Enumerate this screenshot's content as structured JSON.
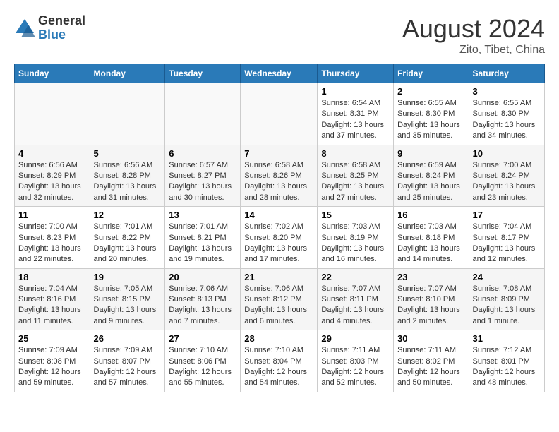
{
  "logo": {
    "general": "General",
    "blue": "Blue"
  },
  "title": "August 2024",
  "subtitle": "Zito, Tibet, China",
  "days_header": [
    "Sunday",
    "Monday",
    "Tuesday",
    "Wednesday",
    "Thursday",
    "Friday",
    "Saturday"
  ],
  "weeks": [
    [
      {
        "day": "",
        "info": ""
      },
      {
        "day": "",
        "info": ""
      },
      {
        "day": "",
        "info": ""
      },
      {
        "day": "",
        "info": ""
      },
      {
        "day": "1",
        "info": "Sunrise: 6:54 AM\nSunset: 8:31 PM\nDaylight: 13 hours and 37 minutes."
      },
      {
        "day": "2",
        "info": "Sunrise: 6:55 AM\nSunset: 8:30 PM\nDaylight: 13 hours and 35 minutes."
      },
      {
        "day": "3",
        "info": "Sunrise: 6:55 AM\nSunset: 8:30 PM\nDaylight: 13 hours and 34 minutes."
      }
    ],
    [
      {
        "day": "4",
        "info": "Sunrise: 6:56 AM\nSunset: 8:29 PM\nDaylight: 13 hours and 32 minutes."
      },
      {
        "day": "5",
        "info": "Sunrise: 6:56 AM\nSunset: 8:28 PM\nDaylight: 13 hours and 31 minutes."
      },
      {
        "day": "6",
        "info": "Sunrise: 6:57 AM\nSunset: 8:27 PM\nDaylight: 13 hours and 30 minutes."
      },
      {
        "day": "7",
        "info": "Sunrise: 6:58 AM\nSunset: 8:26 PM\nDaylight: 13 hours and 28 minutes."
      },
      {
        "day": "8",
        "info": "Sunrise: 6:58 AM\nSunset: 8:25 PM\nDaylight: 13 hours and 27 minutes."
      },
      {
        "day": "9",
        "info": "Sunrise: 6:59 AM\nSunset: 8:24 PM\nDaylight: 13 hours and 25 minutes."
      },
      {
        "day": "10",
        "info": "Sunrise: 7:00 AM\nSunset: 8:24 PM\nDaylight: 13 hours and 23 minutes."
      }
    ],
    [
      {
        "day": "11",
        "info": "Sunrise: 7:00 AM\nSunset: 8:23 PM\nDaylight: 13 hours and 22 minutes."
      },
      {
        "day": "12",
        "info": "Sunrise: 7:01 AM\nSunset: 8:22 PM\nDaylight: 13 hours and 20 minutes."
      },
      {
        "day": "13",
        "info": "Sunrise: 7:01 AM\nSunset: 8:21 PM\nDaylight: 13 hours and 19 minutes."
      },
      {
        "day": "14",
        "info": "Sunrise: 7:02 AM\nSunset: 8:20 PM\nDaylight: 13 hours and 17 minutes."
      },
      {
        "day": "15",
        "info": "Sunrise: 7:03 AM\nSunset: 8:19 PM\nDaylight: 13 hours and 16 minutes."
      },
      {
        "day": "16",
        "info": "Sunrise: 7:03 AM\nSunset: 8:18 PM\nDaylight: 13 hours and 14 minutes."
      },
      {
        "day": "17",
        "info": "Sunrise: 7:04 AM\nSunset: 8:17 PM\nDaylight: 13 hours and 12 minutes."
      }
    ],
    [
      {
        "day": "18",
        "info": "Sunrise: 7:04 AM\nSunset: 8:16 PM\nDaylight: 13 hours and 11 minutes."
      },
      {
        "day": "19",
        "info": "Sunrise: 7:05 AM\nSunset: 8:15 PM\nDaylight: 13 hours and 9 minutes."
      },
      {
        "day": "20",
        "info": "Sunrise: 7:06 AM\nSunset: 8:13 PM\nDaylight: 13 hours and 7 minutes."
      },
      {
        "day": "21",
        "info": "Sunrise: 7:06 AM\nSunset: 8:12 PM\nDaylight: 13 hours and 6 minutes."
      },
      {
        "day": "22",
        "info": "Sunrise: 7:07 AM\nSunset: 8:11 PM\nDaylight: 13 hours and 4 minutes."
      },
      {
        "day": "23",
        "info": "Sunrise: 7:07 AM\nSunset: 8:10 PM\nDaylight: 13 hours and 2 minutes."
      },
      {
        "day": "24",
        "info": "Sunrise: 7:08 AM\nSunset: 8:09 PM\nDaylight: 13 hours and 1 minute."
      }
    ],
    [
      {
        "day": "25",
        "info": "Sunrise: 7:09 AM\nSunset: 8:08 PM\nDaylight: 12 hours and 59 minutes."
      },
      {
        "day": "26",
        "info": "Sunrise: 7:09 AM\nSunset: 8:07 PM\nDaylight: 12 hours and 57 minutes."
      },
      {
        "day": "27",
        "info": "Sunrise: 7:10 AM\nSunset: 8:06 PM\nDaylight: 12 hours and 55 minutes."
      },
      {
        "day": "28",
        "info": "Sunrise: 7:10 AM\nSunset: 8:04 PM\nDaylight: 12 hours and 54 minutes."
      },
      {
        "day": "29",
        "info": "Sunrise: 7:11 AM\nSunset: 8:03 PM\nDaylight: 12 hours and 52 minutes."
      },
      {
        "day": "30",
        "info": "Sunrise: 7:11 AM\nSunset: 8:02 PM\nDaylight: 12 hours and 50 minutes."
      },
      {
        "day": "31",
        "info": "Sunrise: 7:12 AM\nSunset: 8:01 PM\nDaylight: 12 hours and 48 minutes."
      }
    ]
  ]
}
